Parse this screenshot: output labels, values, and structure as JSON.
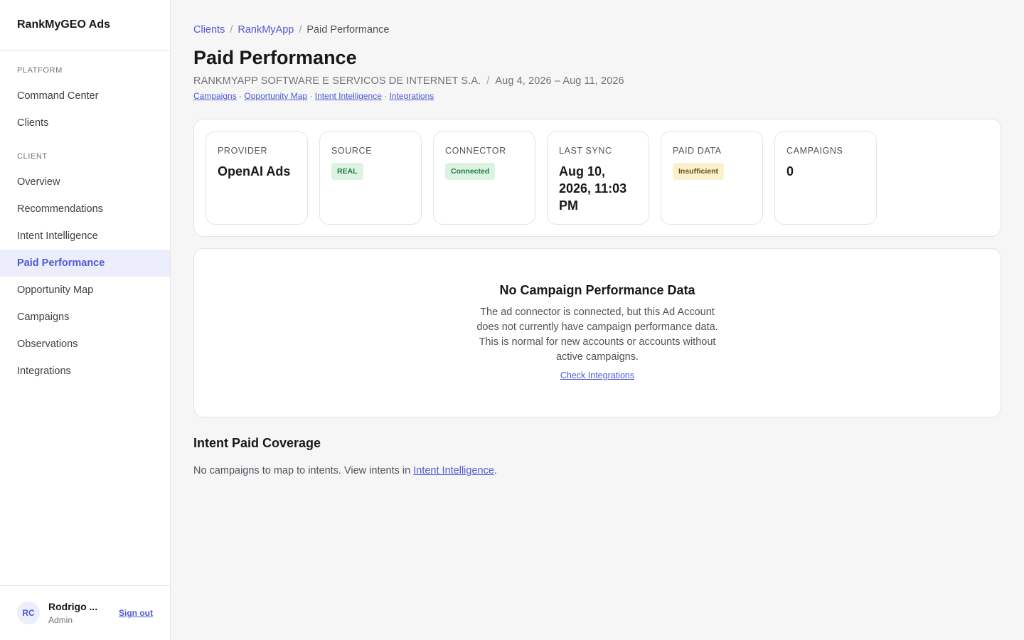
{
  "brand": "RankMyGEO Ads",
  "sidebar": {
    "platform_heading": "PLATFORM",
    "platform_items": [
      {
        "label": "Command Center"
      },
      {
        "label": "Clients"
      }
    ],
    "client_heading": "CLIENT",
    "client_items": [
      {
        "label": "Overview"
      },
      {
        "label": "Recommendations"
      },
      {
        "label": "Intent Intelligence"
      },
      {
        "label": "Paid Performance"
      },
      {
        "label": "Opportunity Map"
      },
      {
        "label": "Campaigns"
      },
      {
        "label": "Observations"
      },
      {
        "label": "Integrations"
      }
    ],
    "active_item": "Paid Performance"
  },
  "user": {
    "initials": "RC",
    "name": "Rodrigo ...",
    "role": "Admin",
    "signout_label": "Sign out"
  },
  "breadcrumb": {
    "items": [
      "Clients",
      "RankMyApp",
      "Paid Performance"
    ],
    "separator": "/"
  },
  "page": {
    "title": "Paid Performance",
    "company": "RANKMYAPP SOFTWARE E SERVICOS DE INTERNET S.A.",
    "date_range": "Aug 4, 2026 – Aug 11, 2026",
    "separator": "/",
    "quick_links": [
      "Campaigns",
      "Opportunity Map",
      "Intent Intelligence",
      "Integrations"
    ],
    "quick_link_separator": "·"
  },
  "stats": {
    "provider": {
      "label": "PROVIDER",
      "value": "OpenAI Ads"
    },
    "source": {
      "label": "SOURCE",
      "badge": "REAL"
    },
    "connector": {
      "label": "CONNECTOR",
      "badge": "Connected"
    },
    "last_sync": {
      "label": "LAST SYNC",
      "value": "Aug 10, 2026, 11:03 PM"
    },
    "paid_data": {
      "label": "PAID DATA",
      "badge": "Insufficient"
    },
    "campaigns": {
      "label": "CAMPAIGNS",
      "value": "0"
    }
  },
  "empty_state": {
    "title": "No Campaign Performance Data",
    "description": "The ad connector is connected, but this Ad Account does not currently have campaign performance data. This is normal for new accounts or accounts without active campaigns.",
    "link_label": "Check Integrations"
  },
  "coverage": {
    "title": "Intent Paid Coverage",
    "text_before": "No campaigns to map to intents. View intents in ",
    "link_label": "Intent Intelligence",
    "text_after": "."
  },
  "colors": {
    "accent": "#4f5bd5",
    "active_bg": "#eceefb",
    "success_bg": "#dcf3e3",
    "success_text": "#1f7a3d",
    "warning_bg": "#fbf1cf",
    "warning_text": "#6b4e0f"
  }
}
